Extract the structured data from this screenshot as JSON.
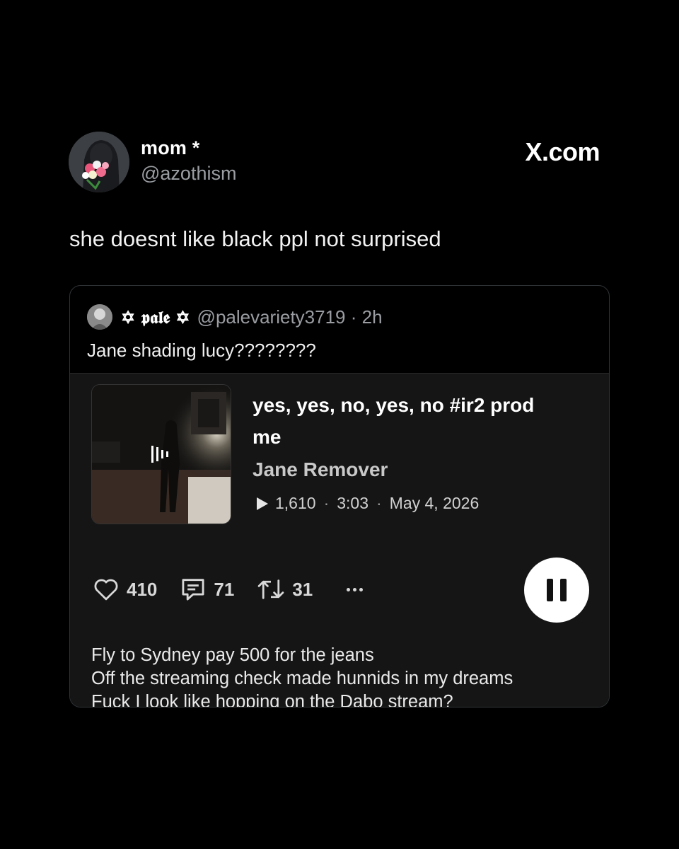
{
  "post": {
    "display_name": "mom *",
    "handle": "@azothism",
    "brand": "X.com",
    "text": "she doesnt like black ppl not surprised",
    "avatar_icon": "profile-photo"
  },
  "quote": {
    "name": "✡ 𝖕𝖆𝖑𝖊 ✡",
    "handle_time": "@palevariety3719 · 2h",
    "text": "Jane shading lucy????????",
    "embed": {
      "title": "yes, yes, no, yes, no #ir2 prod me",
      "artist": "Jane Remover",
      "plays": "1,610",
      "duration": "3:03",
      "date": "May 4, 2026",
      "likes": "410",
      "comments": "71",
      "reposts": "31",
      "lyrics": [
        "Fly to Sydney pay 500 for the jeans",
        "Off the streaming check made hunnids in my dreams",
        "Fuck I look like hopping on the Dabo stream?"
      ],
      "colors": {
        "embed_bg": "#151515",
        "pause_bg": "#ffffff"
      }
    }
  }
}
